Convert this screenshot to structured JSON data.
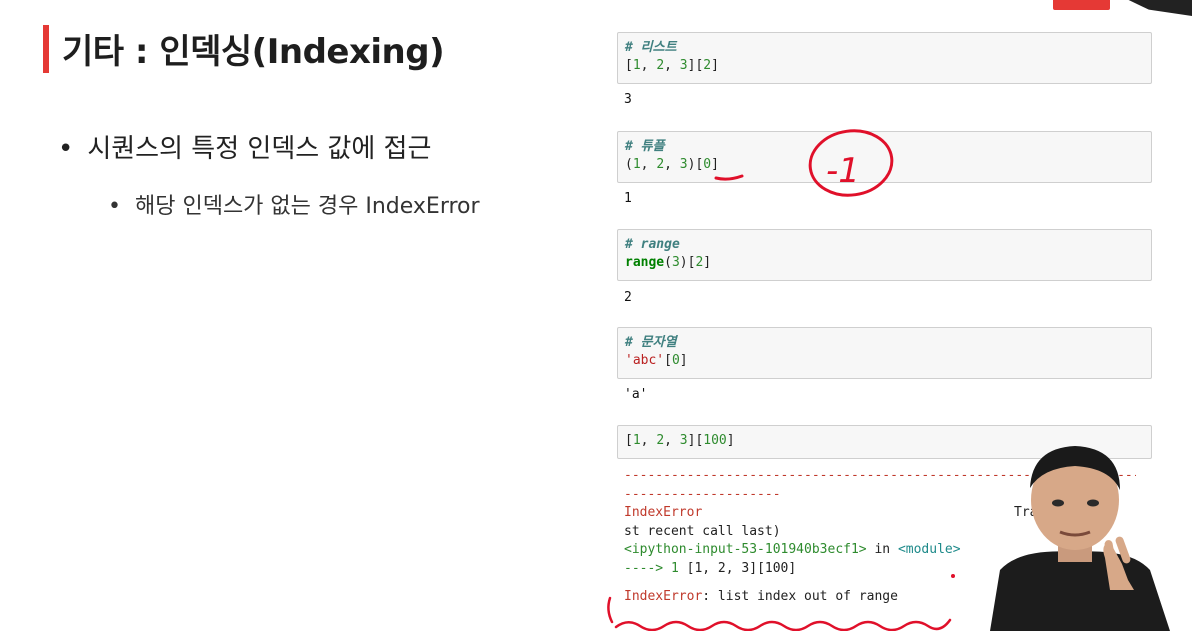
{
  "slide": {
    "title": "기타 : 인덱싱(Indexing)",
    "bullets": [
      "시퀀스의 특정 인덱스 값에 접근",
      "해당 인덱스가 없는 경우 IndexError"
    ],
    "bullet_marker": "•"
  },
  "notebook": {
    "cells": [
      {
        "comment": "# 리스트",
        "code": [
          "[",
          "1",
          ", ",
          "2",
          ", ",
          "3",
          "][",
          "2",
          "]"
        ],
        "output": "3"
      },
      {
        "comment": "# 튜플",
        "code": [
          "(",
          "1",
          ", ",
          "2",
          ", ",
          "3",
          ")[",
          "0",
          "]"
        ],
        "output": "1"
      },
      {
        "comment": "# range",
        "code_fn": "range",
        "code_rest": [
          "(",
          "3",
          ")[",
          "2",
          "]"
        ],
        "output": "2"
      },
      {
        "comment": "# 문자열",
        "code_str": "'abc'",
        "code_rest": [
          "[",
          "0",
          "]"
        ],
        "output": "'a'"
      },
      {
        "code": [
          "[",
          "1",
          ", ",
          "2",
          ", ",
          "3",
          "][",
          "100",
          "]"
        ]
      }
    ],
    "traceback": {
      "dashes_1": "-------------------------------------------------------------------",
      "dashes_2": "--------------------",
      "error_name": "IndexError",
      "header_right": "Traceback (mo",
      "header_cont": "st recent call last)",
      "input_ref": "<ipython-input-53-101940b3ecf1>",
      "in_word": " in ",
      "module_ref": "<module>",
      "arrow": "----> 1 ",
      "arrow_code": "[1, 2, 3][100]",
      "final_error": "IndexError",
      "final_msg": ": list index out of range"
    }
  },
  "annotation": {
    "handwritten": "-1",
    "ink_color": "#e0102a"
  }
}
